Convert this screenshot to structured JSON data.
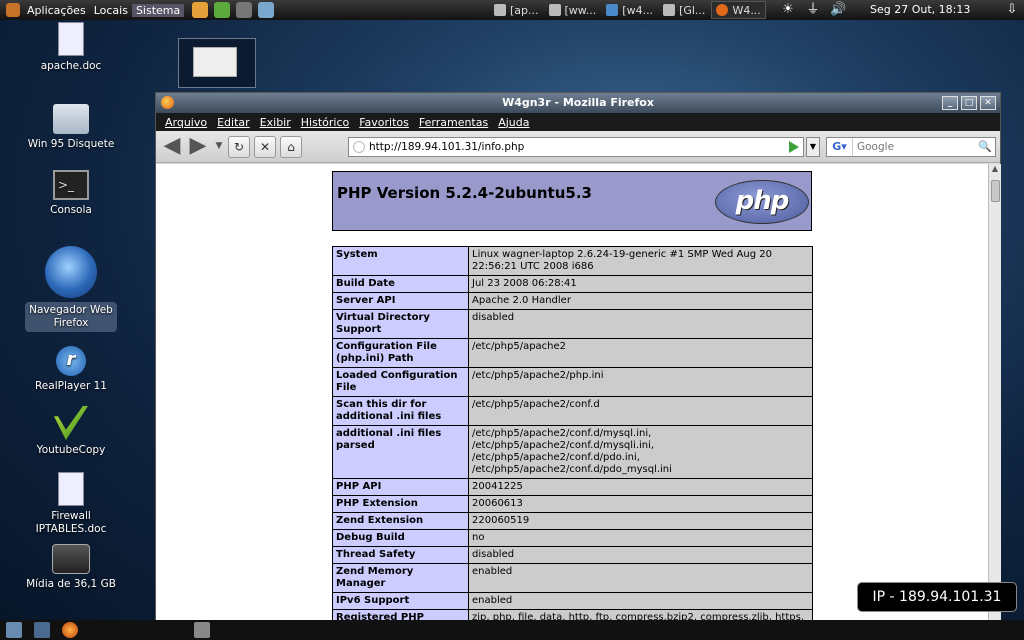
{
  "top_panel": {
    "menus": [
      "Aplicações",
      "Locais",
      "Sistema"
    ],
    "tasks": [
      {
        "label": "[ap..."
      },
      {
        "label": "[ww..."
      },
      {
        "label": "[w4..."
      },
      {
        "label": "[Gl..."
      },
      {
        "label": "W4..."
      }
    ],
    "clock": "Seg 27 Out, 18:13"
  },
  "desktop_icons": [
    {
      "label": "apache.doc",
      "icon": "document-icon"
    },
    {
      "label": "Win 95 Disquete",
      "icon": "folder-icon"
    },
    {
      "label": "Consola",
      "icon": "terminal-icon"
    },
    {
      "label": "Navegador Web\nFirefox",
      "icon": "firefox-icon"
    },
    {
      "label": "RealPlayer 11",
      "icon": "realplayer-icon"
    },
    {
      "label": "YoutubeCopy",
      "icon": "youtubecopy-icon"
    },
    {
      "label": "Firewall IPTABLES.doc",
      "icon": "document-icon"
    },
    {
      "label": "Mídia de 36,1 GB",
      "icon": "harddisk-icon"
    }
  ],
  "browser": {
    "title": "W4gn3r - Mozilla Firefox",
    "menu": [
      "Arquivo",
      "Editar",
      "Exibir",
      "Histórico",
      "Favoritos",
      "Ferramentas",
      "Ajuda"
    ],
    "url": "http://189.94.101.31/info.php",
    "search_placeholder": "Google"
  },
  "phpinfo": {
    "title": "PHP Version 5.2.4-2ubuntu5.3",
    "logo_text": "php",
    "rows": [
      [
        "System",
        "Linux wagner-laptop 2.6.24-19-generic #1 SMP Wed Aug 20 22:56:21 UTC 2008 i686"
      ],
      [
        "Build Date",
        "Jul 23 2008 06:28:41"
      ],
      [
        "Server API",
        "Apache 2.0 Handler"
      ],
      [
        "Virtual Directory Support",
        "disabled"
      ],
      [
        "Configuration File (php.ini) Path",
        "/etc/php5/apache2"
      ],
      [
        "Loaded Configuration File",
        "/etc/php5/apache2/php.ini"
      ],
      [
        "Scan this dir for additional .ini files",
        "/etc/php5/apache2/conf.d"
      ],
      [
        "additional .ini files parsed",
        "/etc/php5/apache2/conf.d/mysql.ini, /etc/php5/apache2/conf.d/mysqli.ini, /etc/php5/apache2/conf.d/pdo.ini, /etc/php5/apache2/conf.d/pdo_mysql.ini"
      ],
      [
        "PHP API",
        "20041225"
      ],
      [
        "PHP Extension",
        "20060613"
      ],
      [
        "Zend Extension",
        "220060519"
      ],
      [
        "Debug Build",
        "no"
      ],
      [
        "Thread Safety",
        "disabled"
      ],
      [
        "Zend Memory Manager",
        "enabled"
      ],
      [
        "IPv6 Support",
        "enabled"
      ],
      [
        "Registered PHP",
        "zip, php, file, data, http, ftp, compress.bzip2, compress.zlib, https,"
      ]
    ]
  },
  "ip_overlay": "IP - 189.94.101.31"
}
